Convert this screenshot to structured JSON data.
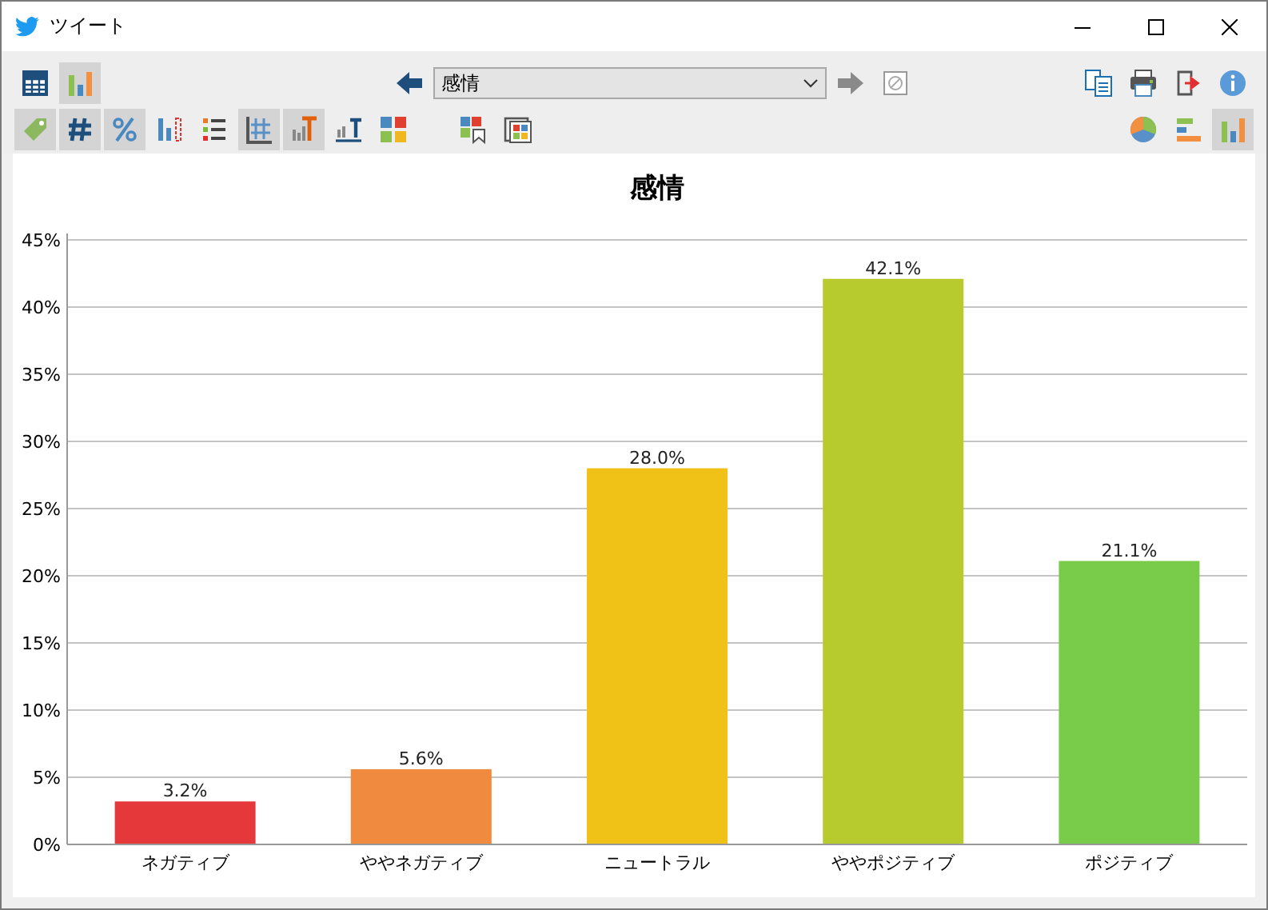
{
  "window": {
    "title": "ツイート"
  },
  "toolbar": {
    "view_buttons": [
      {
        "selected": false
      },
      {
        "selected": true
      }
    ],
    "back": {
      "disabled": false
    },
    "selector": {
      "value": "感情"
    },
    "forward": {
      "disabled": true
    },
    "format_buttons": [
      {
        "selected": true
      },
      {
        "selected": true
      },
      {
        "selected": true
      },
      {
        "selected": false
      },
      {
        "selected": false
      },
      {
        "selected": true
      },
      {
        "selected": true
      },
      {
        "selected": false
      },
      {
        "selected": false
      },
      {
        "selected": false
      },
      {
        "selected": false
      }
    ],
    "chart_type_buttons": [
      {
        "selected": false
      },
      {
        "selected": false
      },
      {
        "selected": true
      }
    ]
  },
  "chart": {
    "chart_data": {
      "type": "bar",
      "title": "感情",
      "categories": [
        "ネガティブ",
        "ややネガティブ",
        "ニュートラル",
        "ややポジティブ",
        "ポジティブ"
      ],
      "values": [
        3.2,
        5.6,
        28.0,
        42.1,
        21.1
      ],
      "grid": true,
      "colors": [
        "#e5383b",
        "#f08a3e",
        "#f0c116",
        "#b8cb2e",
        "#78cc4a"
      ],
      "value_labels": [
        "3.2%",
        "5.6%",
        "28.0%",
        "42.1%",
        "21.1%"
      ],
      "ylim": [
        0,
        45
      ],
      "yticks": [
        {
          "value": 0,
          "label": "0%"
        },
        {
          "value": 5,
          "label": "5%"
        },
        {
          "value": 10,
          "label": "10%"
        },
        {
          "value": 15,
          "label": "15%"
        },
        {
          "value": 20,
          "label": "20%"
        },
        {
          "value": 25,
          "label": "25%"
        },
        {
          "value": 30,
          "label": "30%"
        },
        {
          "value": 35,
          "label": "35%"
        },
        {
          "value": 40,
          "label": "40%"
        },
        {
          "value": 45,
          "label": "45%"
        }
      ]
    }
  }
}
